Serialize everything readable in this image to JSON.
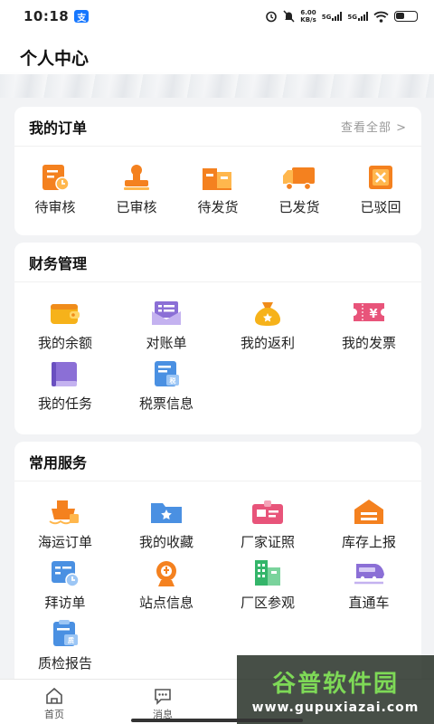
{
  "status_bar": {
    "time": "10:18",
    "badge": "支",
    "speed_value": "6.00",
    "speed_unit": "KB/s",
    "network_1": "5G",
    "network_2": "5G"
  },
  "header": {
    "title": "个人中心"
  },
  "orders": {
    "title": "我的订单",
    "view_all": "查看全部 >",
    "items": [
      {
        "label": "待审核",
        "icon": "pending-review-icon"
      },
      {
        "label": "已审核",
        "icon": "approved-stamp-icon"
      },
      {
        "label": "待发货",
        "icon": "pending-ship-icon"
      },
      {
        "label": "已发货",
        "icon": "shipped-truck-icon"
      },
      {
        "label": "已驳回",
        "icon": "rejected-icon"
      }
    ]
  },
  "finance": {
    "title": "财务管理",
    "items": [
      {
        "label": "我的余额",
        "icon": "wallet-icon"
      },
      {
        "label": "对账单",
        "icon": "statement-icon"
      },
      {
        "label": "我的返利",
        "icon": "money-bag-icon"
      },
      {
        "label": "我的发票",
        "icon": "invoice-icon"
      },
      {
        "label": "我的任务",
        "icon": "task-book-icon"
      },
      {
        "label": "税票信息",
        "icon": "tax-receipt-icon"
      }
    ]
  },
  "services": {
    "title": "常用服务",
    "items": [
      {
        "label": "海运订单",
        "icon": "ship-icon"
      },
      {
        "label": "我的收藏",
        "icon": "favorite-folder-icon"
      },
      {
        "label": "厂家证照",
        "icon": "license-icon"
      },
      {
        "label": "库存上报",
        "icon": "warehouse-icon"
      },
      {
        "label": "拜访单",
        "icon": "visit-form-icon"
      },
      {
        "label": "站点信息",
        "icon": "station-icon"
      },
      {
        "label": "厂区参观",
        "icon": "factory-icon"
      },
      {
        "label": "直通车",
        "icon": "train-icon"
      },
      {
        "label": "质检报告",
        "icon": "quality-report-icon"
      }
    ]
  },
  "bottom_nav": [
    {
      "label": "首页",
      "icon": "home-icon"
    },
    {
      "label": "消息",
      "icon": "message-icon"
    }
  ],
  "watermark": {
    "title": "谷普软件园",
    "url": "www.gupuxiazai.com"
  },
  "colors": {
    "orange": "#f4811f",
    "purple": "#8b6fd6",
    "blue": "#4a90e2",
    "green": "#34b56a",
    "pink": "#e8547a",
    "yellow": "#f6b21a"
  }
}
